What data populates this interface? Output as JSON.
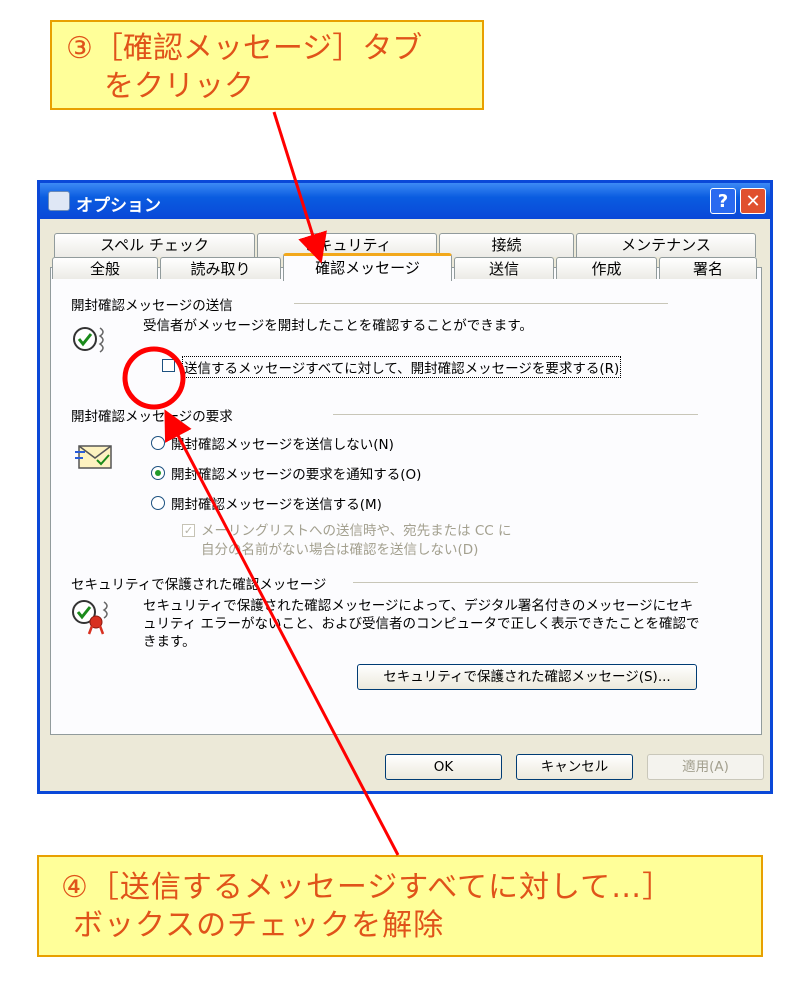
{
  "callouts": {
    "step3": {
      "line1": "③［確認メッセージ］タブ",
      "line2": "をクリック"
    },
    "step4": {
      "line1": "④［送信するメッセージすべてに対して…］",
      "line2": "ボックスのチェックを解除"
    }
  },
  "dialog": {
    "title": "オプション",
    "help_label": "?",
    "close_label": "✕",
    "tabs_back_row": [
      "スペル チェック",
      "セキュリティ",
      "接続",
      "メンテナンス"
    ],
    "tabs_front_row": [
      "全般",
      "読み取り",
      "確認メッセージ",
      "送信",
      "作成",
      "署名"
    ],
    "active_tab": "確認メッセージ",
    "read_receipt_send": {
      "heading": "開封確認メッセージの送信",
      "description": "受信者がメッセージを開封したことを確認することができます。",
      "request_all_label": "送信するメッセージすべてに対して、開封確認メッセージを要求する(R)",
      "request_all_checked": false
    },
    "read_receipt_request": {
      "heading": "開封確認メッセージの要求",
      "options": [
        {
          "label": "開封確認メッセージを送信しない(N)",
          "selected": false
        },
        {
          "label": "開封確認メッセージの要求を通知する(O)",
          "selected": true
        },
        {
          "label": "開封確認メッセージを送信する(M)",
          "selected": false
        }
      ],
      "mailing_list_line1": "メーリングリストへの送信時や、宛先または CC に",
      "mailing_list_line2": "自分の名前がない場合は確認を送信しない(D)",
      "mailing_list_checked": true
    },
    "secure_receipt": {
      "heading": "セキュリティで保護された確認メッセージ",
      "description_line1": "セキュリティで保護された確認メッセージによって、デジタル署名付きのメッセージにセキ",
      "description_line2": "ュリティ エラーがないこと、および受信者のコンピュータで正しく表示できたことを確認で",
      "description_line3": "きます。",
      "button_label": "セキュリティで保護された確認メッセージ(S)..."
    },
    "buttons": {
      "ok": "OK",
      "cancel": "キャンセル",
      "apply": "適用(A)"
    }
  },
  "colors": {
    "annotation_red": "#ff0000",
    "callout_fill": "#ffff99",
    "callout_text": "#e0531a",
    "titlebar_blue": "#0a48d8",
    "active_tab_accent": "#f2a81b"
  },
  "icons": {
    "receipt_send": "checkmark-receipt-icon",
    "receipt_request": "mail-receipt-icon",
    "secure_receipt": "secure-receipt-ribbon-icon"
  }
}
